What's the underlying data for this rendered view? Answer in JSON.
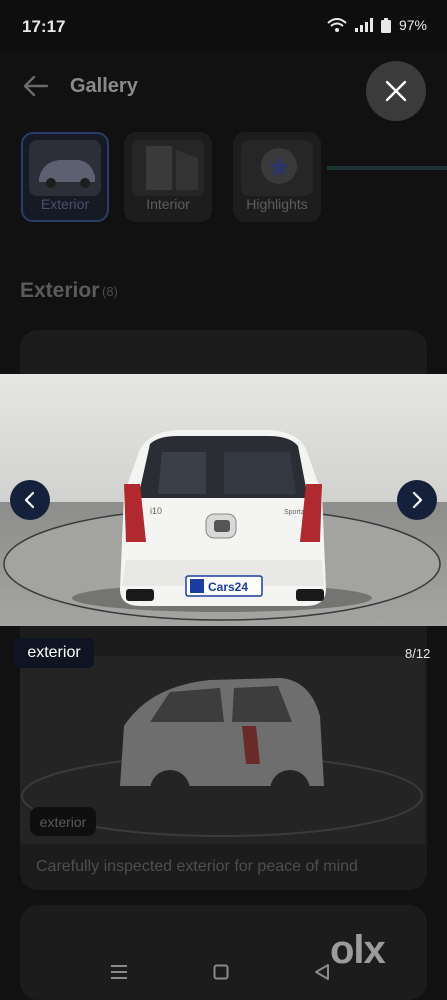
{
  "status_bar": {
    "time": "17:17",
    "battery": "97%"
  },
  "header": {
    "title": "Gallery"
  },
  "tabs": [
    {
      "label": "Exterior",
      "active": true
    },
    {
      "label": "Interior",
      "active": false
    },
    {
      "label": "Highlights",
      "active": false
    }
  ],
  "section": {
    "title": "Exterior",
    "count": "(8)"
  },
  "viewer": {
    "tag": "exterior",
    "counter": "8/12",
    "plate_text": "Cars24",
    "badge_text": "i10",
    "trim_text": "Sportz"
  },
  "background_card": {
    "tag": "exterior",
    "caption": "Carefully inspected exterior for peace of mind"
  },
  "watermark": {
    "text": "olx"
  },
  "colors": {
    "nav_button": "#15203a",
    "active_tab_border": "#2b3b6a"
  },
  "icons": [
    "back-arrow-icon",
    "close-icon",
    "chevron-left-icon",
    "chevron-right-icon",
    "menu-icon",
    "home-square-icon",
    "back-triangle-icon"
  ]
}
